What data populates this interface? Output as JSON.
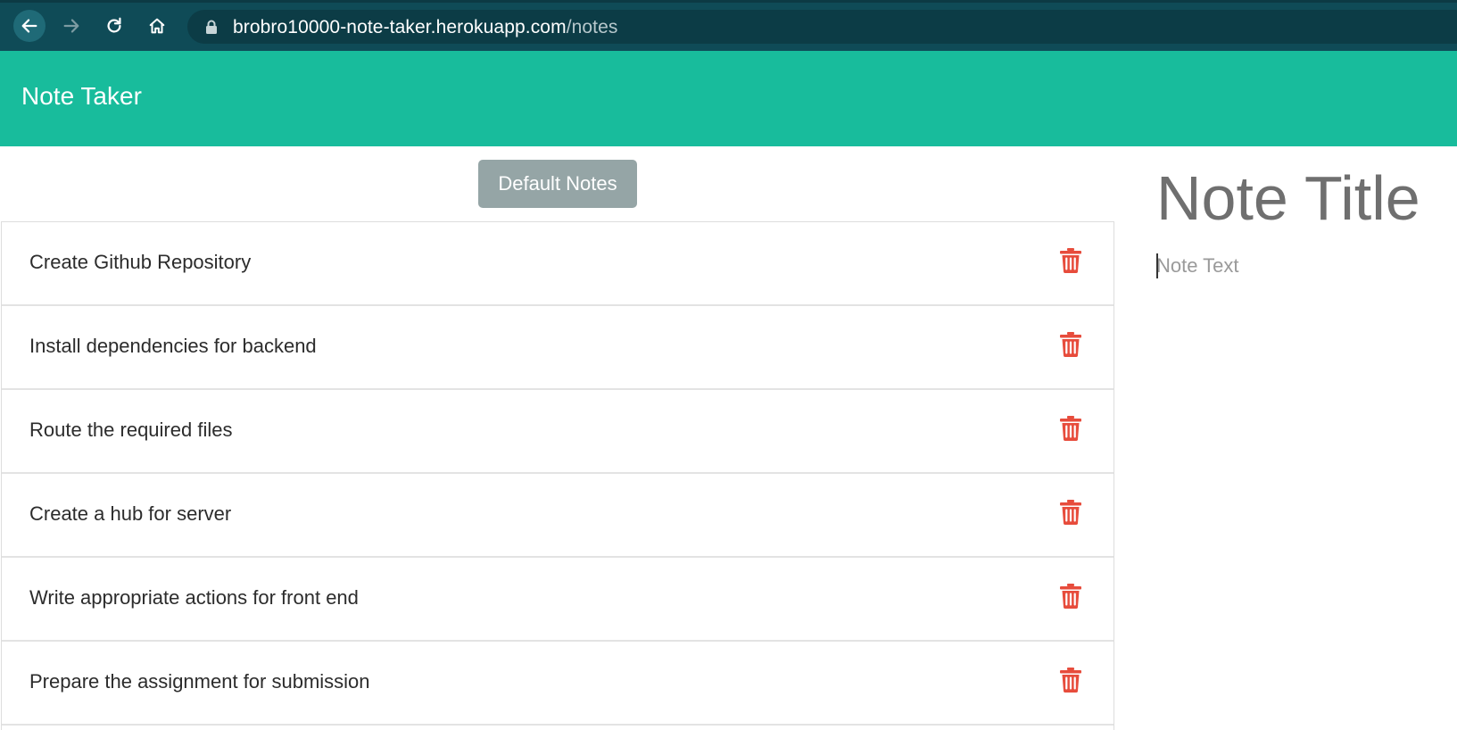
{
  "browser": {
    "url_host": "brobro10000-note-taker.herokuapp.com",
    "url_path": "/notes"
  },
  "app": {
    "title": "Note Taker",
    "default_button_label": "Default Notes"
  },
  "notes": [
    {
      "title": "Create Github Repository"
    },
    {
      "title": "Install dependencies for backend"
    },
    {
      "title": "Route the required files"
    },
    {
      "title": "Create a hub for server"
    },
    {
      "title": "Write appropriate actions for front end"
    },
    {
      "title": "Prepare the assignment for submission"
    }
  ],
  "editor": {
    "title_placeholder": "Note Title",
    "text_placeholder": "Note Text"
  },
  "colors": {
    "header": "#18bc9c",
    "trash": "#e74c3c",
    "button": "#95a5a6"
  }
}
